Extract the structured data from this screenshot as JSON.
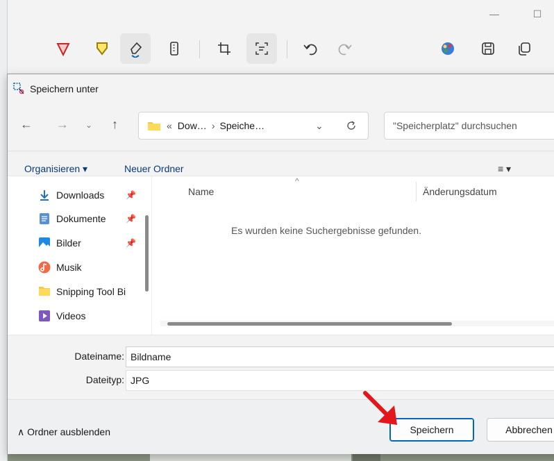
{
  "tool": {
    "minimize": "—",
    "maximize": "☐"
  },
  "dialog": {
    "title": "Speichern unter",
    "address": {
      "prefix": "«",
      "part1": "Dow…",
      "sep": "›",
      "part2": "Speiche…"
    },
    "search_placeholder": "\"Speicherplatz\" durchsuchen",
    "commands": {
      "organize": "Organisieren ▾",
      "new_folder": "Neuer Ordner",
      "view": "≡ ▾"
    },
    "nav_items": [
      {
        "label": "Downloads",
        "icon": "download-icon",
        "pinned": true
      },
      {
        "label": "Dokumente",
        "icon": "document-icon",
        "pinned": true
      },
      {
        "label": "Bilder",
        "icon": "pictures-icon",
        "pinned": true
      },
      {
        "label": "Musik",
        "icon": "music-icon",
        "pinned": false
      },
      {
        "label": "Snipping Tool Bi",
        "icon": "folder-icon",
        "pinned": false
      },
      {
        "label": "Videos",
        "icon": "videos-icon",
        "pinned": false
      }
    ],
    "columns": {
      "name": "Name",
      "date": "Änderungsdatum"
    },
    "empty_message": "Es wurden keine Suchergebnisse gefunden.",
    "filename_label": "Dateiname:",
    "filename_value": "Bildname",
    "filetype_label": "Dateityp:",
    "filetype_value": "JPG",
    "hide_folders": "∧  Ordner ausblenden",
    "save_button": "Speichern",
    "cancel_button": "Abbrechen"
  },
  "colors": {
    "accent": "#0067c0",
    "annotation_arrow": "#e3161b"
  }
}
